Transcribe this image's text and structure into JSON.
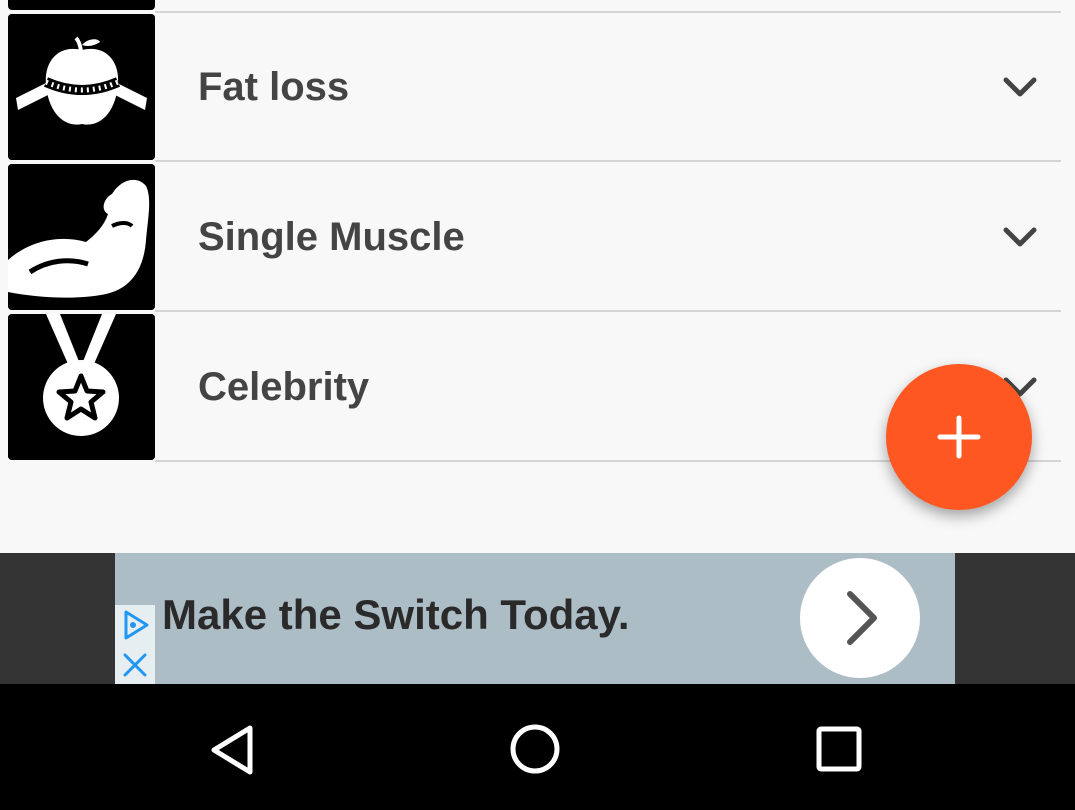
{
  "categories": [
    {
      "label": "Fat loss",
      "icon": "apple-tape-measure-icon"
    },
    {
      "label": "Single Muscle",
      "icon": "flexed-bicep-icon"
    },
    {
      "label": "Celebrity",
      "icon": "star-medal-icon"
    }
  ],
  "fab": {
    "icon": "plus-icon",
    "color": "#ff5722"
  },
  "ad": {
    "headline": "Make the Switch Today.",
    "cta_icon": "chevron-right-icon",
    "adchoices_icon": "adchoices-icon",
    "close_icon": "close-icon"
  },
  "navbar": {
    "back_icon": "back-triangle-icon",
    "home_icon": "home-circle-icon",
    "recents_icon": "recents-square-icon"
  }
}
